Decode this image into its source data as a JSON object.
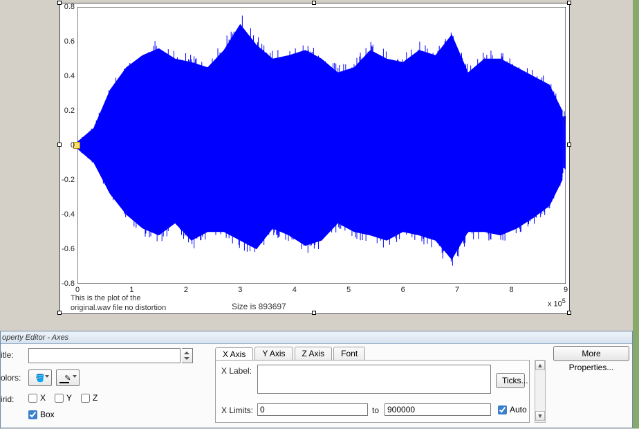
{
  "figure": {
    "y_ticks": [
      "-0.8",
      "-0.6",
      "-0.4",
      "-0.2",
      "0",
      "0.2",
      "0.4",
      "0.6",
      "0.8"
    ],
    "x_ticks": [
      "0",
      "1",
      "2",
      "3",
      "4",
      "5",
      "6",
      "7",
      "8",
      "9"
    ],
    "x_exp_label": "x 10",
    "x_exp_sup": "5",
    "annotation_left_l1": "This is the plot of the",
    "annotation_left_l2": "original.wav file no distortion",
    "annotation_size": "Size is 893697"
  },
  "chart_data": {
    "type": "line",
    "title": "",
    "xlabel": "",
    "ylabel": "",
    "xlim": [
      0,
      900000
    ],
    "ylim": [
      -0.8,
      0.8
    ],
    "x_tick_values": [
      0,
      100000,
      200000,
      300000,
      400000,
      500000,
      600000,
      700000,
      800000,
      900000
    ],
    "y_tick_values": [
      -0.8,
      -0.6,
      -0.4,
      -0.2,
      0,
      0.2,
      0.4,
      0.6,
      0.8
    ],
    "x_tick_scale_label": "x 10^5",
    "description": "Dense audio waveform (amplitude vs sample index) of original.wav, ~893697 samples. Values oscillate roughly between -0.7 and 0.7.",
    "series": [
      {
        "name": "original.wav amplitude",
        "color": "#0000ff",
        "note": "Approximate envelope (upper/lower) sampled every ~30000 samples, read from plot.",
        "x_envelope": [
          0,
          30000,
          60000,
          90000,
          120000,
          150000,
          180000,
          210000,
          240000,
          270000,
          300000,
          330000,
          360000,
          390000,
          420000,
          450000,
          480000,
          510000,
          540000,
          570000,
          600000,
          630000,
          660000,
          690000,
          720000,
          750000,
          780000,
          810000,
          840000,
          870000,
          893697
        ],
        "upper": [
          0.02,
          0.1,
          0.32,
          0.45,
          0.52,
          0.56,
          0.5,
          0.48,
          0.45,
          0.55,
          0.7,
          0.58,
          0.5,
          0.52,
          0.55,
          0.5,
          0.42,
          0.45,
          0.55,
          0.5,
          0.48,
          0.55,
          0.52,
          0.64,
          0.42,
          0.5,
          0.5,
          0.45,
          0.4,
          0.35,
          0.2
        ],
        "lower": [
          -0.02,
          -0.1,
          -0.28,
          -0.4,
          -0.48,
          -0.52,
          -0.45,
          -0.55,
          -0.5,
          -0.5,
          -0.55,
          -0.6,
          -0.48,
          -0.52,
          -0.58,
          -0.55,
          -0.45,
          -0.5,
          -0.52,
          -0.55,
          -0.5,
          -0.52,
          -0.55,
          -0.66,
          -0.5,
          -0.5,
          -0.52,
          -0.48,
          -0.42,
          -0.35,
          -0.2
        ]
      }
    ]
  },
  "editor": {
    "panel_title": "operty Editor - Axes",
    "title_label": "itle:",
    "title_value": "",
    "colors_label": "olors:",
    "grid_label": "irid:",
    "grid_x": "X",
    "grid_y": "Y",
    "grid_z": "Z",
    "box_label": "Box",
    "tabs": {
      "x": "X Axis",
      "y": "Y Axis",
      "z": "Z Axis",
      "font": "Font"
    },
    "xlabel_label": "X Label:",
    "xlabel_value": "",
    "xlimits_label": "X Limits:",
    "xlim_lo": "0",
    "xlim_to": "to",
    "xlim_hi": "900000",
    "auto_label": "Auto",
    "ticks_btn": "Ticks...",
    "more_btn": "More Properties..."
  }
}
